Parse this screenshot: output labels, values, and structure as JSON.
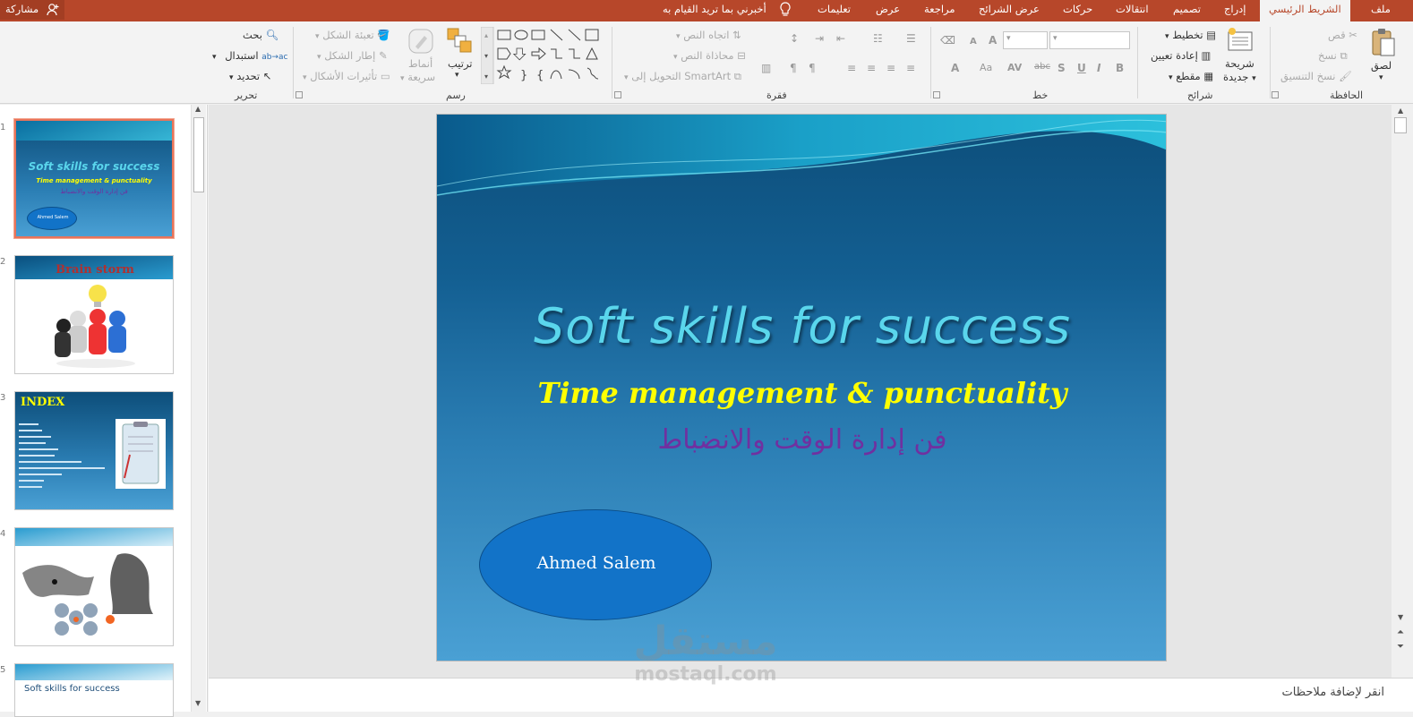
{
  "tabs": {
    "file": "ملف",
    "home": "الشريط الرئيسي",
    "insert": "إدراج",
    "design": "تصميم",
    "transitions": "انتقالات",
    "animations": "حركات",
    "slideshow": "عرض الشرائح",
    "review": "مراجعة",
    "view": "عرض",
    "help": "تعليمات",
    "tellme": "أخبرني بما تريد القيام به",
    "share": "مشاركة"
  },
  "ribbon": {
    "clipboard": {
      "label": "الحافظة",
      "paste": "لصق",
      "cut": "قص",
      "copy": "نسخ",
      "format_painter": "نسخ التنسيق"
    },
    "slides": {
      "label": "شرائح",
      "new_slide_1": "شريحة",
      "new_slide_2": "جديدة",
      "layout": "تخطيط",
      "reset": "إعادة تعيين",
      "section": "مقطع"
    },
    "font": {
      "label": "خط",
      "bold": "B",
      "italic": "I",
      "underline": "U",
      "shadow": "S",
      "strike": "abc",
      "spacing": "AV",
      "case": "Aa",
      "color": "A",
      "grow": "A",
      "shrink": "A"
    },
    "paragraph": {
      "label": "فقرة",
      "text_direction": "اتجاه النص",
      "align_text": "محاذاة النص",
      "smartart": "التحويل إلى SmartArt"
    },
    "drawing": {
      "label": "رسم",
      "arrange": "ترتيب",
      "quick_styles_1": "أنماط",
      "quick_styles_2": "سريعة",
      "shape_fill": "تعبئة الشكل",
      "shape_outline": "إطار الشكل",
      "shape_effects": "تأثيرات الأشكال"
    },
    "editing": {
      "label": "تحرير",
      "find": "بحث",
      "replace": "استبدال",
      "select": "تحديد",
      "replace_icon_text": "ab\nac"
    }
  },
  "thumbnails": {
    "numbers": [
      "1",
      "2",
      "3",
      "4",
      "5"
    ],
    "slide1": {
      "title": "Soft skills for success",
      "subtitle": "Time management & punctuality",
      "arabic": "فن إدارة الوقت والانضباط",
      "name": "Ahmed Salem"
    },
    "slide2": {
      "title": "Brain storm"
    },
    "slide3": {
      "title": "INDEX"
    },
    "slide5": {
      "title": "Soft skills for success"
    }
  },
  "slide": {
    "title": "Soft skills for success",
    "subtitle": "Time management & punctuality",
    "arabic": "فن إدارة الوقت والانضباط",
    "oval_text": "Ahmed Salem"
  },
  "notes": {
    "placeholder": "انقر لإضافة ملاحظات"
  },
  "watermark": {
    "arabic": "مستقل",
    "domain": "mostaql.com"
  },
  "colors": {
    "accent": "#b7472a",
    "title_cyan": "#5ad6ec",
    "subtitle_yellow": "#ffff00",
    "arabic_purple": "#7030a0",
    "oval_blue": "#1273c8"
  }
}
